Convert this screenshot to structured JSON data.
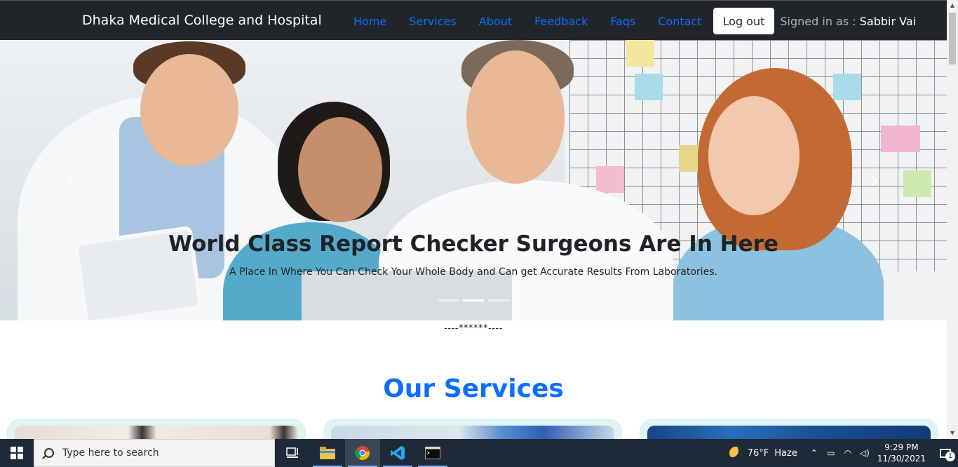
{
  "navbar": {
    "brand": "Dhaka Medical College and Hospital",
    "links": [
      "Home",
      "Services",
      "About",
      "Feedback",
      "Faqs",
      "Contact"
    ],
    "logout_label": "Log out",
    "signed_in_prefix": "Signed in as :",
    "user_name": "Sabbir Vai"
  },
  "hero": {
    "title": "World Class Report Checker Surgeons Are In Here",
    "subtitle": "A Place In Where You Can Check Your Whole Body and Can get Accurate Results From Laboratories.",
    "prev_glyph": "‹",
    "next_glyph": "›",
    "slide_count": 3,
    "active_slide": 2
  },
  "divider": "----******----",
  "services": {
    "title": "Our Services"
  },
  "taskbar": {
    "search_placeholder": "Type here to search",
    "weather_temp": "76°F",
    "weather_desc": "Haze",
    "time": "9:29 PM",
    "date": "11/30/2021",
    "notification_count": "1",
    "apps": [
      "task-view",
      "file-explorer",
      "chrome",
      "vscode",
      "terminal"
    ]
  },
  "colors": {
    "navbar_bg": "#212529",
    "link": "#0d6efd",
    "section_title": "#0d6efd",
    "card_bg": "#dff3f3",
    "taskbar_bg": "#1f2a38"
  }
}
